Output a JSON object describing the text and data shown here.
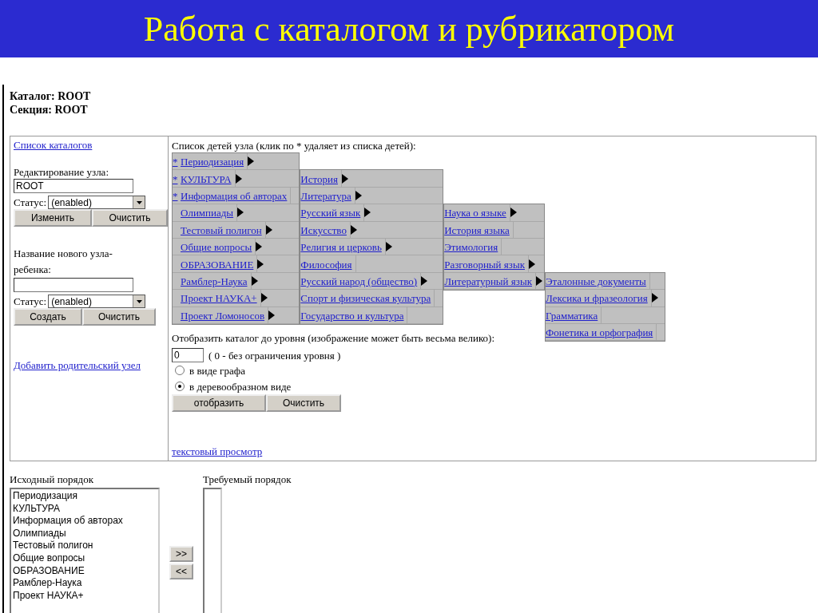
{
  "slide_title": "Работа с каталогом и рубрикатором",
  "header": {
    "catalog": "Каталог: ROOT",
    "section": "Секция: ROOT"
  },
  "left_panel": {
    "catalogs_link": "Список каталогов",
    "edit": {
      "label": "Редактирование узла:",
      "value": "ROOT",
      "status_label": "Статус:",
      "status_value": "(enabled)",
      "buttons": [
        "Изменить",
        "Очистить"
      ]
    },
    "create": {
      "label": "Название нового узла-ребенка:",
      "status_label": "Статус:",
      "status_value": "(enabled)",
      "buttons": [
        "Создать",
        "Очистить"
      ]
    },
    "add_parent_link": "Добавить родительский узел"
  },
  "children_panel": {
    "heading": "Список детей узла (клик по * удаляет из списка детей):",
    "menu": [
      {
        "label": "Периодизация",
        "marker": "*",
        "arrow": true
      },
      {
        "label": "КУЛЬТУРА",
        "marker": "*",
        "arrow": true,
        "children": [
          {
            "label": "История",
            "arrow": true
          },
          {
            "label": "Литература",
            "arrow": true
          },
          {
            "label": "Русский язык",
            "arrow": true,
            "children": [
              {
                "label": "Наука о языке",
                "arrow": true
              },
              {
                "label": "История языка",
                "arrow": false
              },
              {
                "label": "Этимология",
                "arrow": false
              },
              {
                "label": "Разговорный язык",
                "arrow": true
              },
              {
                "label": "Литературный язык",
                "arrow": true,
                "children": [
                  {
                    "label": "Эталонные документы",
                    "arrow": false
                  },
                  {
                    "label": "Лексика и фразеология",
                    "arrow": true
                  },
                  {
                    "label": "Грамматика",
                    "arrow": false
                  },
                  {
                    "label": "Фонетика и орфография",
                    "arrow": false
                  }
                ]
              }
            ]
          },
          {
            "label": "Искусство",
            "arrow": true
          },
          {
            "label": "Религия и церковь",
            "arrow": true
          },
          {
            "label": "Философия",
            "arrow": false
          },
          {
            "label": "Русский народ (общество)",
            "arrow": true
          },
          {
            "label": "Спорт и физическая культура",
            "arrow": false
          },
          {
            "label": "Государство и культура",
            "arrow": false
          }
        ]
      },
      {
        "label": "Информация об авторах",
        "marker": "*",
        "arrow": false
      },
      {
        "label": "Олимпиады",
        "arrow": true
      },
      {
        "label": "Тестовый полигон",
        "arrow": true
      },
      {
        "label": "Общие вопросы",
        "arrow": true
      },
      {
        "label": "ОБРАЗОВАНИЕ",
        "arrow": true
      },
      {
        "label": "Рамблер-Наука",
        "arrow": true
      },
      {
        "label": "Проект НАУКА+",
        "arrow": true
      },
      {
        "label": "Проект Ломоносов",
        "arrow": true
      }
    ],
    "display": {
      "label": "Отобразить каталог до уровня (изображение может быть весьма велико):",
      "level_value": "0",
      "level_hint": "( 0 - без ограничения уровня )",
      "modes": [
        {
          "label": "в виде графа",
          "selected": false
        },
        {
          "label": "в деревообразном виде",
          "selected": true
        }
      ],
      "buttons": [
        "отобразить",
        "Очистить"
      ]
    },
    "text_view_link": "текстовый просмотр"
  },
  "order": {
    "source_label": "Исходный порядок",
    "source_items": [
      "Периодизация",
      "КУЛЬТУРА",
      "Информация об авторах",
      "Олимпиады",
      "Тестовый полигон",
      "Общие вопросы",
      "ОБРАЗОВАНИЕ",
      "Рамблер-Наука",
      "Проект НАУКА+"
    ],
    "move_buttons": [
      ">>",
      "<<"
    ],
    "target_label": "Требуемый порядок"
  }
}
